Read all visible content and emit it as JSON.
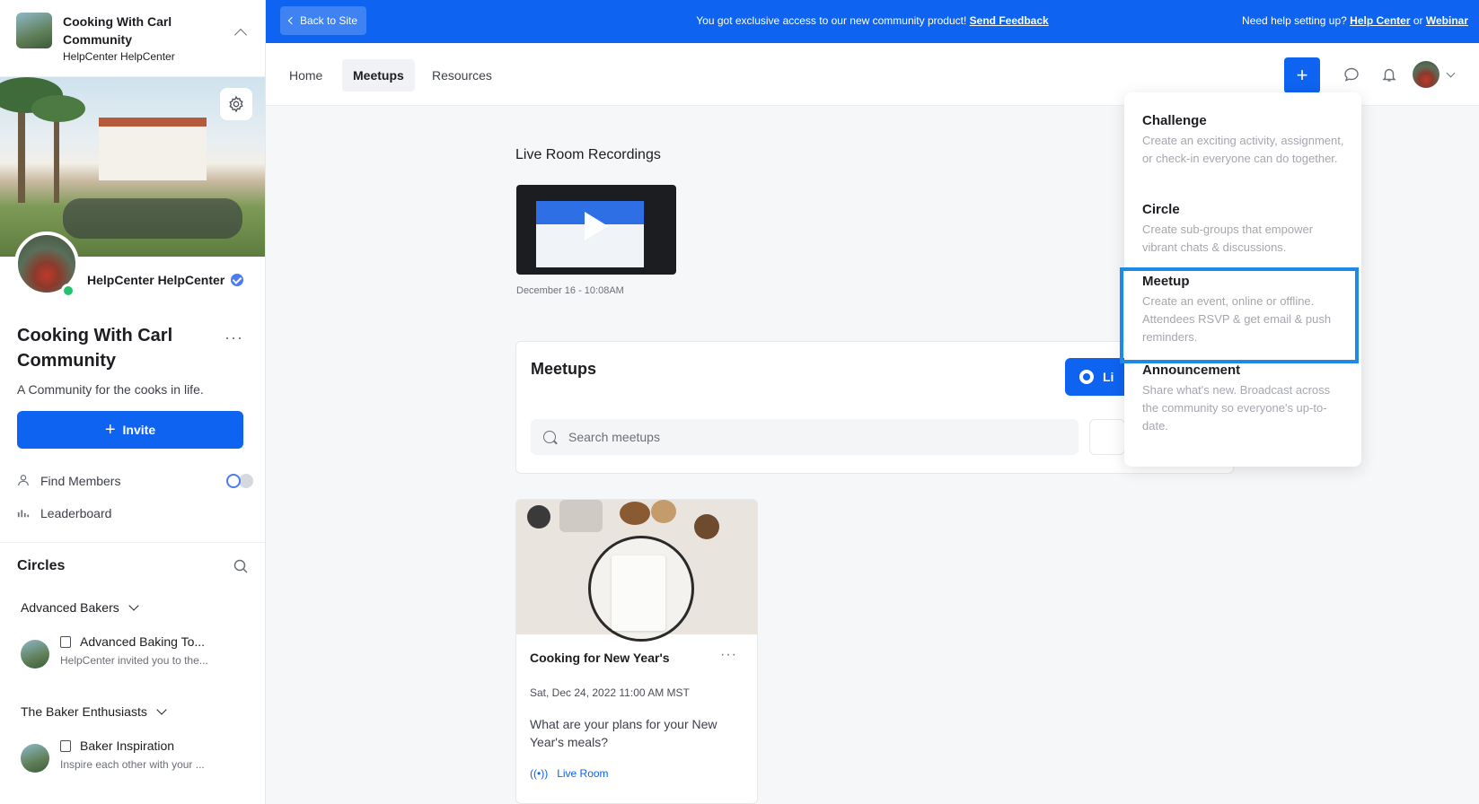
{
  "sidebar": {
    "community": {
      "name": "Cooking With Carl Community",
      "owner": "HelpCenter HelpCenter"
    },
    "profile_name": "HelpCenter HelpCenter",
    "title": "Cooking With Carl Community",
    "tagline": "A Community for the cooks in life.",
    "invite_label": "Invite",
    "links": {
      "find_members": "Find Members",
      "leaderboard": "Leaderboard"
    },
    "circles_heading": "Circles",
    "groups": [
      {
        "name": "Advanced Bakers",
        "item": {
          "title": "Advanced Baking To...",
          "subtitle": "HelpCenter invited you to the..."
        }
      },
      {
        "name": "The Baker Enthusiasts",
        "item": {
          "title": "Baker Inspiration",
          "subtitle": "Inspire each other with your ..."
        }
      }
    ]
  },
  "banner": {
    "back_label": "Back to Site",
    "message": "You got exclusive access to our new community product!",
    "feedback_link": "Send Feedback",
    "help_text": "Need help setting up?",
    "help_link": "Help Center",
    "or_text": "or",
    "webinar_link": "Webinar"
  },
  "nav": {
    "tabs": [
      "Home",
      "Meetups",
      "Resources"
    ],
    "active_tab": "Meetups",
    "plus_label": "+"
  },
  "main": {
    "recordings_title": "Live Room Recordings",
    "recording_date": "December 16 - 10:08AM",
    "meetups_title": "Meetups",
    "live_button": "Li",
    "search_placeholder": "Search meetups",
    "event": {
      "title": "Cooking for New Year's",
      "date": "Sat, Dec 24, 2022 11:00 AM MST",
      "description": "What are your plans for your New Year's meals?",
      "live_label": "Live Room"
    }
  },
  "dropdown": {
    "items": [
      {
        "title": "Challenge",
        "description": "Create an exciting activity, assignment, or check-in everyone can do together."
      },
      {
        "title": "Circle",
        "description": "Create sub-groups that empower vibrant chats & discussions."
      },
      {
        "title": "Meetup",
        "description": "Create an event, online or offline. Attendees RSVP & get email & push reminders."
      },
      {
        "title": "Announcement",
        "description": "Share what's new. Broadcast across the community so everyone's up-to-date."
      }
    ],
    "highlighted": "Meetup"
  },
  "colors": {
    "brand": "#0e63f0",
    "highlight": "#1f8ae6",
    "online": "#22c36a"
  }
}
